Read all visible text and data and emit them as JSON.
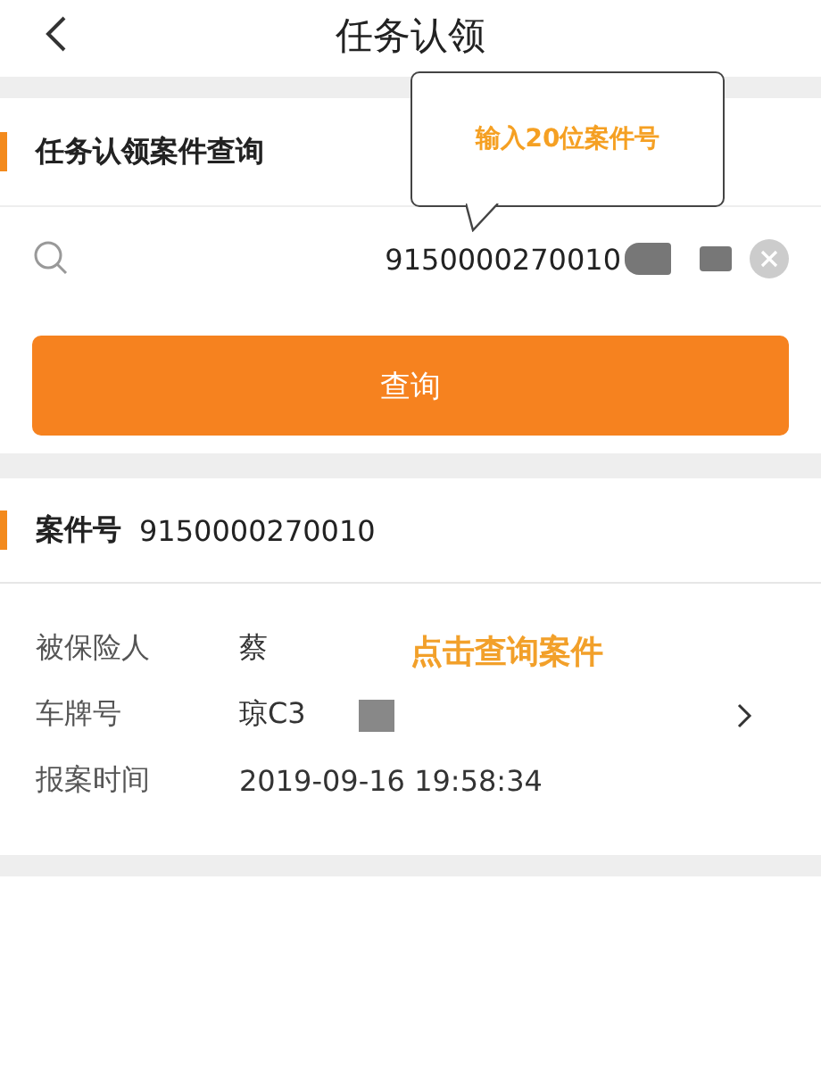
{
  "header": {
    "title": "任务认领"
  },
  "query": {
    "section_title": "任务认领案件查询",
    "search": {
      "value": "9150000270010"
    },
    "button": "查询"
  },
  "case": {
    "label": "案件号",
    "value": "9150000270010",
    "details": [
      {
        "label": "被保险人",
        "value": "蔡",
        "chevron": false
      },
      {
        "label": "车牌号",
        "value": "琼C3",
        "chevron": true
      },
      {
        "label": "报案时间",
        "value": "2019-09-16 19:58:34",
        "chevron": false
      }
    ]
  },
  "annotations": {
    "bubble": "输入20位案件号",
    "note": "点击查询案件"
  }
}
